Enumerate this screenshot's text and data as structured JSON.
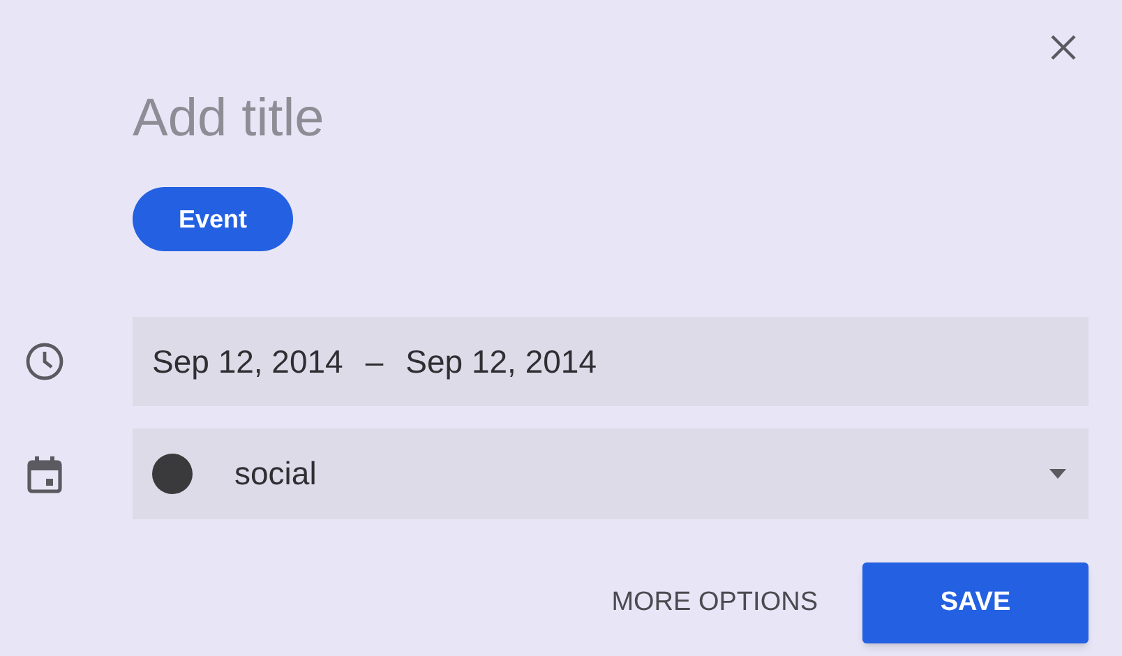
{
  "title_field": {
    "placeholder": "Add title"
  },
  "type_chips": [
    {
      "label": "Event",
      "selected": true
    }
  ],
  "date_range": {
    "start": "Sep 12, 2014",
    "separator": "–",
    "end": "Sep 12, 2014"
  },
  "calendar": {
    "name": "social",
    "color": "#3a3a3c"
  },
  "buttons": [
    {
      "label": "MORE OPTIONS",
      "kind": "text"
    },
    {
      "label": "SAVE",
      "kind": "primary"
    }
  ]
}
